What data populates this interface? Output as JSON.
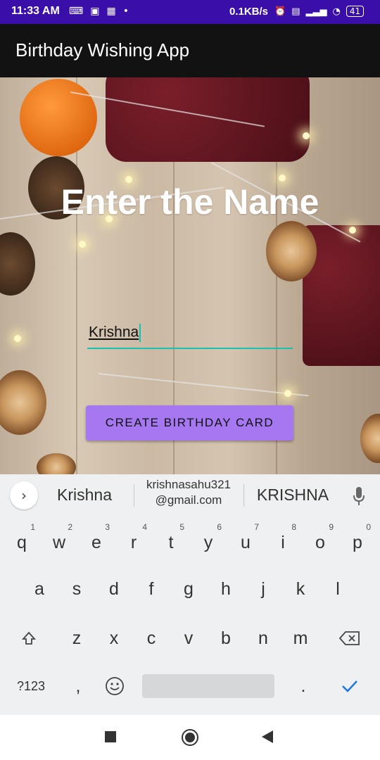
{
  "status_bar": {
    "time": "11:33 AM",
    "left_icons": [
      "keyboard-icon",
      "screen-icon",
      "grid-icon",
      "dot-icon"
    ],
    "network_speed": "0.1KB/s",
    "right_icons": [
      "alarm-icon",
      "volte-icon",
      "signal-icon",
      "wifi-icon"
    ],
    "battery": "41"
  },
  "app_bar": {
    "title": "Birthday Wishing App"
  },
  "main": {
    "heading": "Enter the Name",
    "name_input": {
      "value": "Krishna"
    },
    "create_button": "CREATE BIRTHDAY CARD"
  },
  "suggestions": {
    "items": [
      "Krishna",
      "krishnasahu321",
      "@gmail.com",
      "KRISHNA"
    ]
  },
  "keyboard": {
    "row1": [
      {
        "key": "q",
        "hint": "1"
      },
      {
        "key": "w",
        "hint": "2"
      },
      {
        "key": "e",
        "hint": "3"
      },
      {
        "key": "r",
        "hint": "4"
      },
      {
        "key": "t",
        "hint": "5"
      },
      {
        "key": "y",
        "hint": "6"
      },
      {
        "key": "u",
        "hint": "7"
      },
      {
        "key": "i",
        "hint": "8"
      },
      {
        "key": "o",
        "hint": "9"
      },
      {
        "key": "p",
        "hint": "0"
      }
    ],
    "row2": [
      "a",
      "s",
      "d",
      "f",
      "g",
      "h",
      "j",
      "k",
      "l"
    ],
    "row3": [
      "z",
      "x",
      "c",
      "v",
      "b",
      "n",
      "m"
    ],
    "symbols_label": "?123",
    "comma": ",",
    "period": "."
  },
  "colors": {
    "status_bar": "#3a0ea8",
    "app_bar": "#121212",
    "button": "#a577f0",
    "input_underline": "#18c2b3",
    "enter_key": "#1a73e8"
  }
}
